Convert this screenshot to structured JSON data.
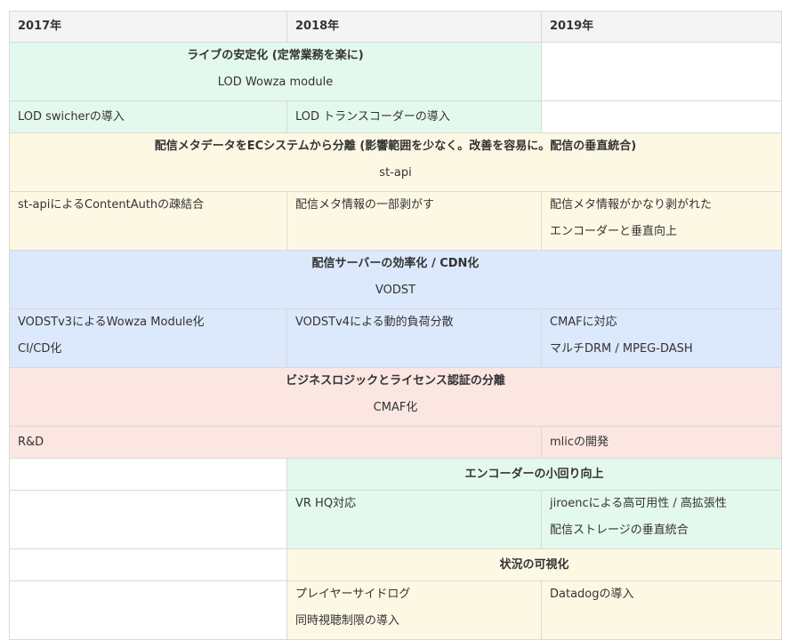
{
  "header": [
    "2017年",
    "2018年",
    "2019年"
  ],
  "s1": {
    "title": "ライブの安定化 (定常業務を楽に)",
    "sub": "LOD Wowza module",
    "c2017": "LOD swicherの導入",
    "c2018": "LOD トランスコーダーの導入"
  },
  "s2": {
    "title": "配信メタデータをECシステムから分離 (影響範囲を少なく。改善を容易に。配信の垂直統合)",
    "sub": "st-api",
    "c2017": "st-apiによるContentAuthの疎結合",
    "c2018": "配信メタ情報の一部剥がす",
    "c2019a": "配信メタ情報がかなり剥がれた",
    "c2019b": "エンコーダーと垂直向上"
  },
  "s3": {
    "title": "配信サーバーの効率化 / CDN化",
    "sub": "VODST",
    "c2017a": "VODSTv3によるWowza Module化",
    "c2017b": "CI/CD化",
    "c2018": "VODSTv4による動的負荷分散",
    "c2019a": "CMAFに対応",
    "c2019b": "マルチDRM / MPEG-DASH"
  },
  "s4": {
    "title": "ビジネスロジックとライセンス認証の分離",
    "sub": "CMAF化",
    "c2017": "R&D",
    "c2019": "mlicの開発"
  },
  "s5": {
    "title": "エンコーダーの小回り向上",
    "c2018": "VR HQ対応",
    "c2019a": "jiroencによる高可用性 / 高拡張性",
    "c2019b": "配信ストレージの垂直統合"
  },
  "s6": {
    "title": "状況の可視化",
    "c2018a": "プレイヤーサイドログ",
    "c2018b": "同時視聴制限の導入",
    "c2019": "Datadogの導入"
  }
}
